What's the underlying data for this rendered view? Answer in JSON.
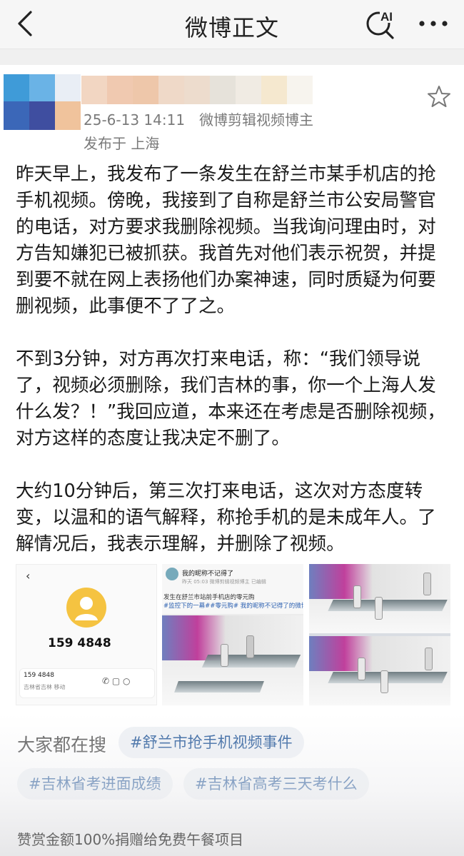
{
  "header": {
    "title": "微博正文",
    "ai_label": "AI"
  },
  "post": {
    "date": "25-6-13 14:11",
    "source": "微博剪辑视频博主",
    "location": "发布于 上海",
    "paragraphs": [
      "昨天早上，我发布了一条发生在舒兰市某手机店的抢手机视频。傍晚，我接到了自称是舒兰市公安局警官的电话，对方要求我删除视频。当我询问理由时，对方告知嫌犯已被抓获。我首先对他们表示祝贺，并提到要不就在网上表扬他们办案神速，同时质疑为何要删视频，此事便不了了之。",
      "不到3分钟，对方再次打来电话，称：“我们领导说了，视频必须删除，我们吉林的事，你一个上海人发什么发？！”我回应道，本来还在考虑是否删除视频，对方这样的态度让我决定不删了。",
      "大约10分钟后，第三次打来电话，这次对方态度转变，以温和的语气解释，称抢手机的是未成年人。了解情况后，我表示理解，并删除了视频。"
    ]
  },
  "images": {
    "call": {
      "number": "159 4848",
      "number_small": "159 4848",
      "location_small": "吉林省吉林 移动"
    },
    "repost": {
      "name": "我的昵称不记得了",
      "meta": "昨天 05:03  微博剪辑视频博主  已编辑",
      "text1": "发生在舒兰市站前手机店的零元购",
      "text2": "#监控下的一幕##零元购# 我的昵称不记得了的微博视频"
    }
  },
  "search": {
    "label": "大家都在搜",
    "tags": [
      "#舒兰市抢手机视频事件",
      "#吉林省考进面成绩",
      "#吉林省高考三天考什么"
    ]
  },
  "footer": {
    "reward": "赞赏金额100%捐赠给免费午餐项目"
  }
}
